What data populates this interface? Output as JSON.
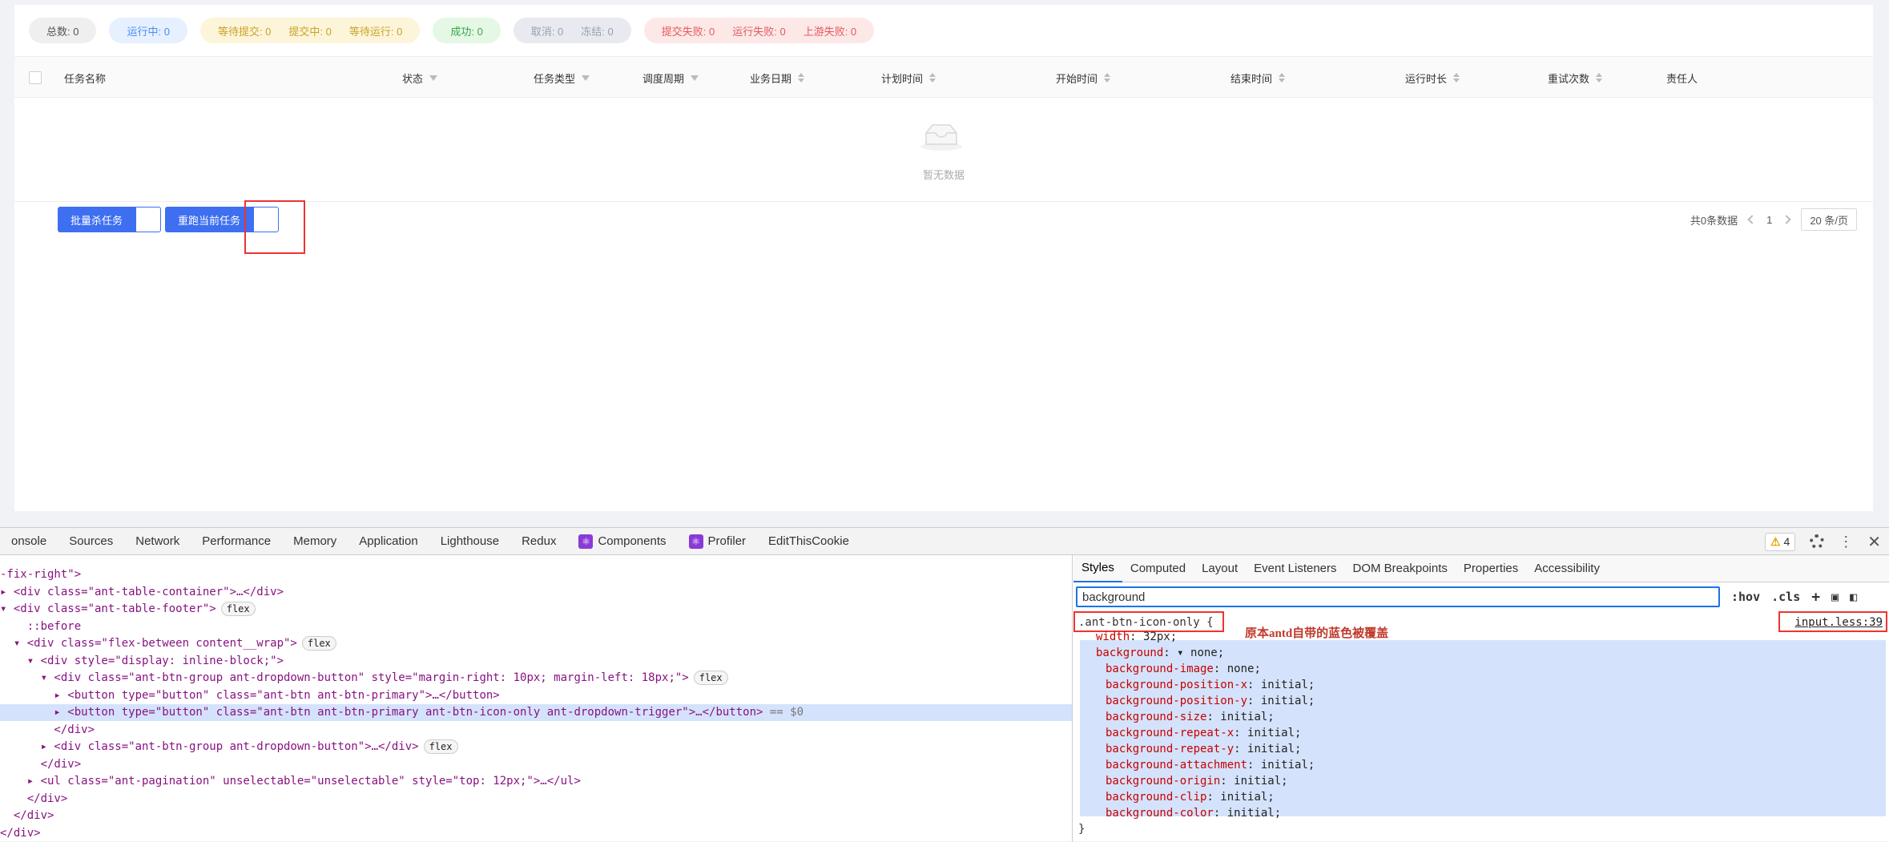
{
  "status_pills": [
    {
      "color": "gray",
      "items": [
        "总数: 0"
      ]
    },
    {
      "color": "blue",
      "items": [
        "运行中: 0"
      ]
    },
    {
      "color": "yellow",
      "items": [
        "等待提交: 0",
        "提交中: 0",
        "等待运行: 0"
      ]
    },
    {
      "color": "green",
      "items": [
        "成功: 0"
      ]
    },
    {
      "color": "slate",
      "items": [
        "取消: 0",
        "冻结: 0"
      ]
    },
    {
      "color": "red",
      "items": [
        "提交失败: 0",
        "运行失败: 0",
        "上游失败: 0"
      ]
    }
  ],
  "table": {
    "columns": [
      {
        "label": "任务名称",
        "icon": ""
      },
      {
        "label": "状态",
        "icon": "filter-icon"
      },
      {
        "label": "任务类型",
        "icon": "filter-icon"
      },
      {
        "label": "调度周期",
        "icon": "filter-icon"
      },
      {
        "label": "业务日期",
        "icon": "sort-icon"
      },
      {
        "label": "计划时间",
        "icon": "sort-icon"
      },
      {
        "label": "开始时间",
        "icon": "sort-icon"
      },
      {
        "label": "结束时间",
        "icon": "sort-icon"
      },
      {
        "label": "运行时长",
        "icon": "sort-icon"
      },
      {
        "label": "重试次数",
        "icon": "sort-icon"
      },
      {
        "label": "责任人",
        "icon": ""
      }
    ],
    "empty_text": "暂无数据"
  },
  "footer": {
    "batch_kill_label": "批量杀任务",
    "rerun_label": "重跑当前任务",
    "total_text": "共0条数据",
    "current_page": "1",
    "page_size": "20 条/页"
  },
  "devtools": {
    "tabs": [
      "onsole",
      "Sources",
      "Network",
      "Performance",
      "Memory",
      "Application",
      "Lighthouse",
      "Redux",
      "Components",
      "Profiler",
      "EditThisCookie"
    ],
    "warning_count": "4",
    "style_tabs": [
      "Styles",
      "Computed",
      "Layout",
      "Event Listeners",
      "DOM Breakpoints",
      "Properties",
      "Accessibility"
    ],
    "filter_value": "background",
    "hov_label": ":hov",
    "cls_label": ".cls",
    "selector": ".ant-btn-icon-only {",
    "source": "input.less:39",
    "annotation": "原本antd自带的蓝色被覆盖",
    "props": [
      {
        "name": "width",
        "value": " 32px;"
      },
      {
        "name": "background",
        "value": " ▾ none;"
      },
      {
        "name": "background-image",
        "value": " none;"
      },
      {
        "name": "background-position-x",
        "value": " initial;"
      },
      {
        "name": "background-position-y",
        "value": " initial;"
      },
      {
        "name": "background-size",
        "value": " initial;"
      },
      {
        "name": "background-repeat-x",
        "value": " initial;"
      },
      {
        "name": "background-repeat-y",
        "value": " initial;"
      },
      {
        "name": "background-attachment",
        "value": " initial;"
      },
      {
        "name": "background-origin",
        "value": " initial;"
      },
      {
        "name": "background-clip",
        "value": " initial;"
      },
      {
        "name": "background-color",
        "value": " initial;"
      }
    ],
    "rule_close": "}",
    "elements_lines": [
      "-fix-right\">",
      "▸ <div class=\"ant-table-container\">…</div>",
      "▾ <div class=\"ant-table-footer\">",
      "    ::before",
      "  ▾ <div class=\"flex-between content__wrap\">",
      "    ▾ <div style=\"display: inline-block;\">",
      "      ▾ <div class=\"ant-btn-group ant-dropdown-button\" style=\"margin-right: 10px; margin-left: 18px;\">",
      "        ▸ <button type=\"button\" class=\"ant-btn ant-btn-primary\">…</button>",
      "        ▸ <button type=\"button\" class=\"ant-btn ant-btn-primary ant-btn-icon-only ant-dropdown-trigger\">…</button>",
      "        </div>",
      "      ▸ <div class=\"ant-btn-group ant-dropdown-button\">…</div>",
      "      </div>",
      "    ▸ <ul class=\"ant-pagination\" unselectable=\"unselectable\" style=\"top: 12px;\">…</ul>",
      "    </div>",
      "  </div>",
      "</div>"
    ],
    "selected_suffix": " == $0"
  },
  "colors": {
    "primary": "#3d6ff0",
    "highlight": "#d4e3fb",
    "annotation": "#c0392b",
    "red_box": "#ee3333"
  }
}
